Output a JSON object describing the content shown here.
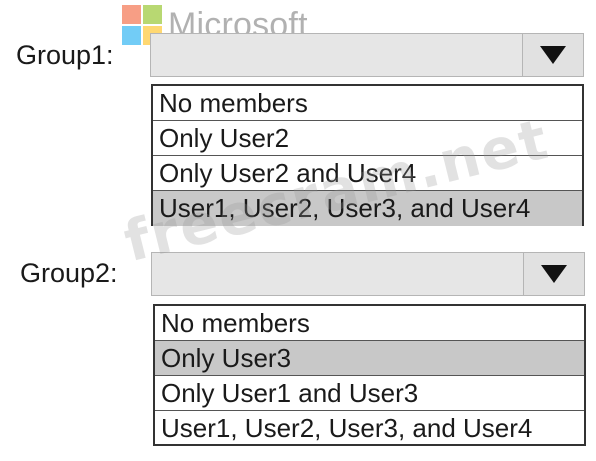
{
  "logo": {
    "text": "Microsoft"
  },
  "watermark": {
    "text": "freecram.net"
  },
  "groups": [
    {
      "label": "Group1:",
      "selected": "",
      "options": [
        "No members",
        "Only User2",
        "Only User2 and User4",
        "User1, User2, User3, and User4"
      ],
      "highlighted_index": 3
    },
    {
      "label": "Group2:",
      "selected": "",
      "options": [
        "No members",
        "Only User3",
        "Only User1 and User3",
        "User1, User2, User3, and User4"
      ],
      "highlighted_index": 1
    }
  ],
  "colors": {
    "highlight": "#c8c8c8",
    "select_bg": "#e6e6e6"
  },
  "icons": {
    "dropdown": "triangle-down-icon"
  }
}
